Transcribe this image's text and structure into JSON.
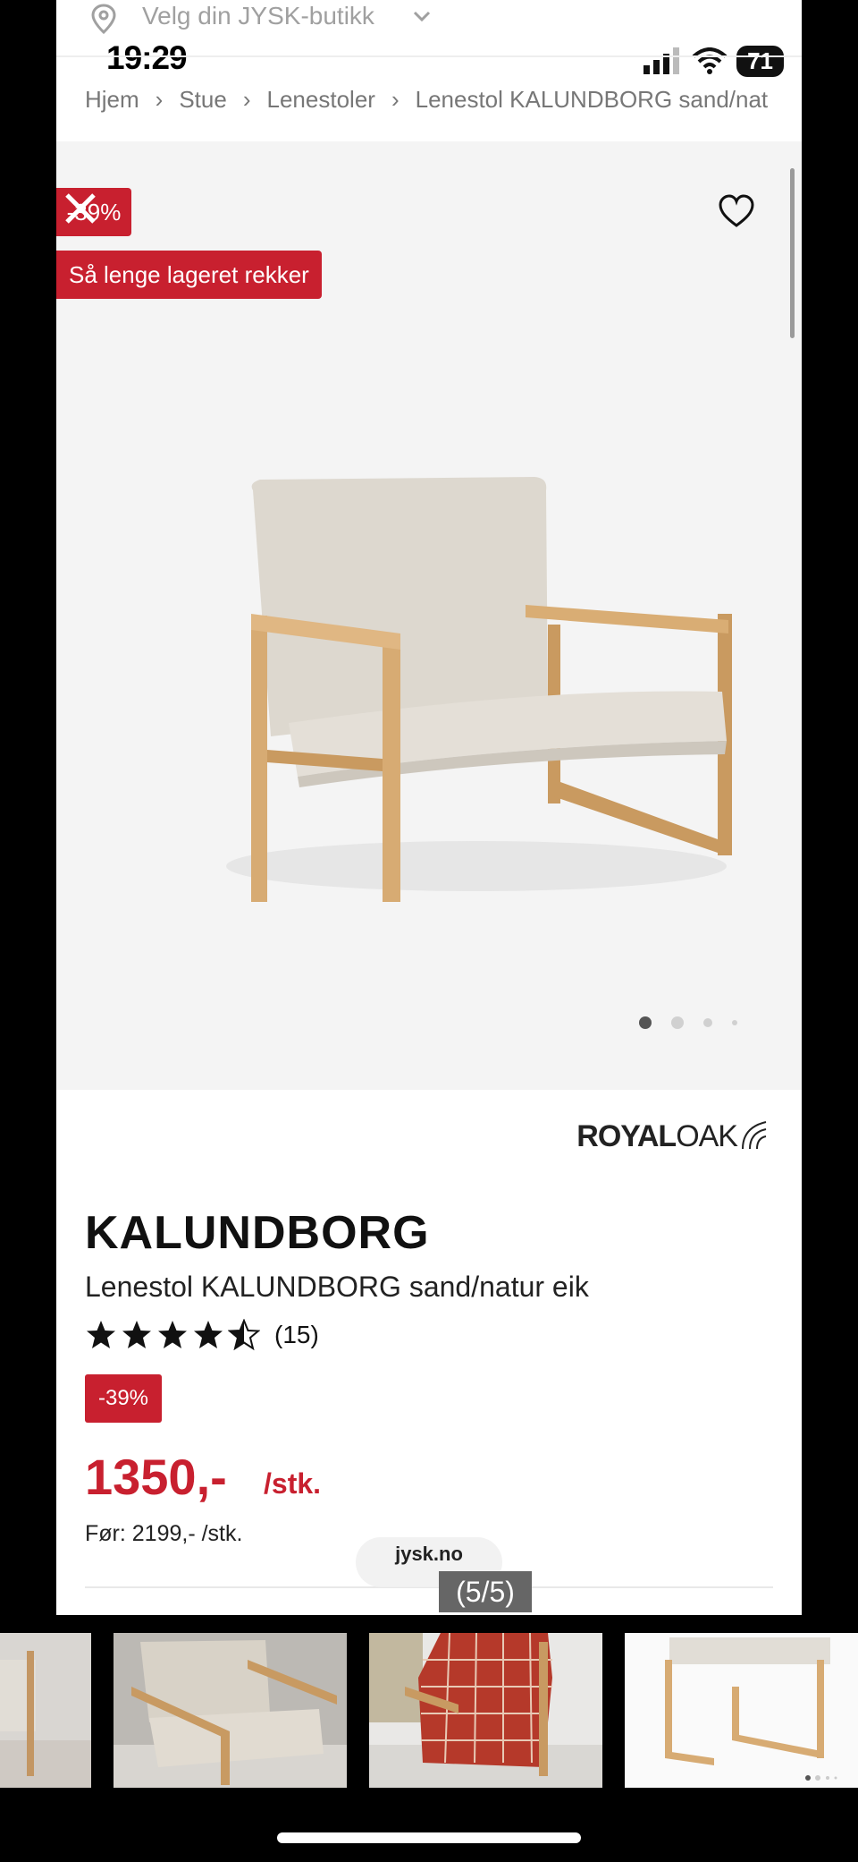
{
  "status_bar": {
    "time": "19:29",
    "battery": "71"
  },
  "store_selector": {
    "label": "Velg din JYSK-butikk"
  },
  "breadcrumb": [
    "Hjem",
    "Stue",
    "Lenestoler",
    "Lenestol KALUNDBORG sand/nat"
  ],
  "hero": {
    "discount_badge": "-39%",
    "stock_badge": "Så lenge lageret rekker",
    "image_dots": 4,
    "active_dot": 1
  },
  "product": {
    "brand": {
      "bold": "ROYAL",
      "light": "OAK"
    },
    "name": "KALUNDBORG",
    "subtitle": "Lenestol KALUNDBORG sand/natur eik",
    "rating": {
      "value": 4.5,
      "count": "(15)"
    },
    "discount": "-39%",
    "price": "1350,-",
    "unit": "/stk.",
    "previous_price": "Før: 2199,- /stk."
  },
  "browser": {
    "url": "jysk.no"
  },
  "gallery": {
    "counter": "(5/5)",
    "thumbnail_count": 5,
    "selected_index": 5
  },
  "colors": {
    "brand_red": "#c8202f",
    "oak": "#d7ab73",
    "fabric": "#e2ddd5"
  }
}
